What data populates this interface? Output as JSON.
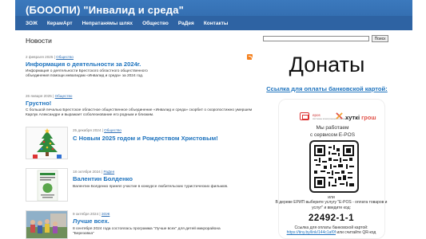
{
  "header": {
    "site_title": "(БОООПИ) \"Инвалид и среда\"",
    "nav": [
      "ЗОЖ",
      "КерамАрт",
      "Непратанямы шлях",
      "Общество",
      "РаДея",
      "Контакты"
    ]
  },
  "left": {
    "section_title": "Новости",
    "posts": [
      {
        "meta_date": "2 февраля 2025 | ",
        "meta_category": "Общество",
        "title": "Информация о деятельности за 2024г.",
        "text": "Информация о деятельности Брестского областного общественного объединения помощи инвалидам «Инвалид и среда» за 2024 год."
      },
      {
        "meta_date": "26 января 2025 | ",
        "meta_category": "Общество",
        "title": "Грустно!",
        "text": "С большой печалью Брестское областное общественное объединение «Инвалид и среда» скорбит о скоропостижно умершем  Карлук Александре и выражает соболезнование его родным и близким."
      },
      {
        "meta_date": "25 декабря 2024 | ",
        "meta_category": "Общество",
        "title": "С Новым 2025 годом и Рождеством Христовым!",
        "text": ""
      },
      {
        "meta_date": "18 октября 2024 | ",
        "meta_category": "РаДея",
        "title": "Валентин Болденко",
        "text": "Валентин Болденко принял участие в конкурсе любительских туристических фильмов."
      },
      {
        "meta_date": "9 октября 2024 | ",
        "meta_category": "ЗОЖ",
        "title": "Лучше всех.",
        "text": "8 сентября 2024 года состоялась программа \"Лучше всех\" для  детей микрорайона \"Березовка\""
      }
    ]
  },
  "right": {
    "search_button": "Поиск",
    "donate_title": "Донаты",
    "bank_link": "Ссылка для оплаты банковской картой:",
    "card": {
      "epos_label": "epos",
      "epos_sub": "системы электронных платежей",
      "hutki_label_1": "хуткі",
      "hutki_label_2": " грош",
      "service_line1": "Мы работаем",
      "service_line2": "с сервисом E-POS"
    },
    "pay_line1": "или",
    "pay_line2": "В дереве ЕРИП выберите услугу \"E-POS - оплата товаров и услуг\" и введите код:",
    "pay_code": "22492-1-1",
    "pay_line3": "Ссылка для оплаты банковской картой:",
    "pay_link": "https://tiny.by/link/144c1af0f",
    "pay_line4": " или считайте QR-код"
  },
  "colors": {
    "header_blue": "#3b79bd",
    "nav_blue": "#2e63a3",
    "link_blue": "#1e73be",
    "rss_orange": "#f58220",
    "epos_red": "#d33333"
  }
}
